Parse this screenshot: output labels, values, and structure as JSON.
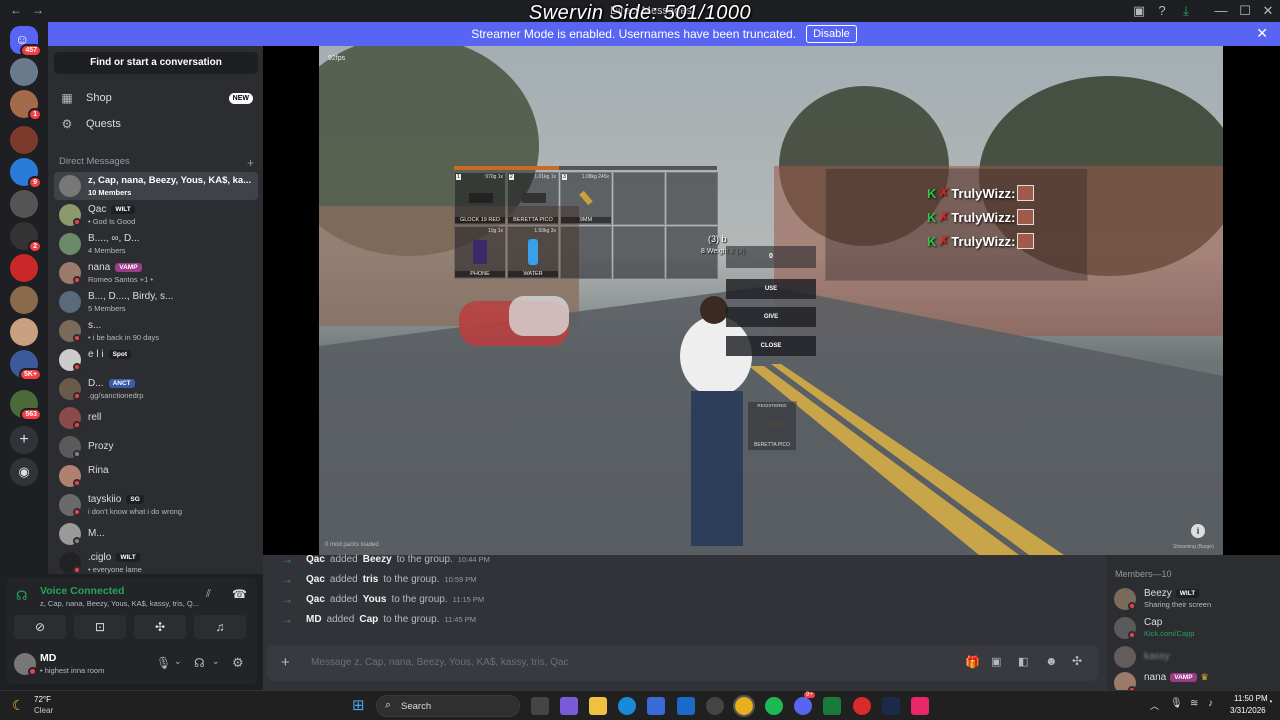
{
  "window": {
    "back": "←",
    "forward": "→",
    "title": "Direct Messages",
    "overlay_title": "Swervin Side: 501/1000"
  },
  "streamer_banner": {
    "text": "Streamer Mode is enabled. Usernames have been truncated.",
    "button": "Disable"
  },
  "guilds": {
    "home_badge": "457",
    "badges": [
      "1",
      "9",
      "2",
      "5K+",
      "563"
    ]
  },
  "sidebar": {
    "find": "Find or start a conversation",
    "shop": "Shop",
    "shop_badge": "NEW",
    "quests": "Quests",
    "dm_header": "Direct Messages",
    "add_dm": "+"
  },
  "dms": [
    {
      "name": "z, Cap, nana, Beezy, Yous, KA$, ka...",
      "sub": "10 Members",
      "tag": ""
    },
    {
      "name": "Qac",
      "sub": "• God Is Good",
      "tag": "WILT"
    },
    {
      "name": "B...., ∞, D...",
      "sub": "4 Members",
      "tag": ""
    },
    {
      "name": "nana",
      "sub": "Romeo Santos +1 •",
      "tag": "VAMP"
    },
    {
      "name": "B..., D...., Birdy, s...",
      "sub": "5 Members",
      "tag": ""
    },
    {
      "name": "s...",
      "sub": "• i be back in 90 days",
      "tag": ""
    },
    {
      "name": "e l i",
      "sub": "",
      "tag": "Spot"
    },
    {
      "name": "D...",
      "sub": ".gg/sanctionedrp",
      "tag": "ANCT"
    },
    {
      "name": "rell",
      "sub": "",
      "tag": ""
    },
    {
      "name": "Prozy",
      "sub": "",
      "tag": ""
    },
    {
      "name": "Rina",
      "sub": "",
      "tag": ""
    },
    {
      "name": "tayskiio",
      "sub": "i don't know what i do wrong",
      "tag": "SG"
    },
    {
      "name": "M...",
      "sub": "",
      "tag": ""
    },
    {
      "name": ".ciglo",
      "sub": "• everyone lame",
      "tag": "WILT"
    }
  ],
  "voice": {
    "status": "Voice Connected",
    "channel": "z, Cap, nana, Beezy, Yous, KA$, kassy, tris, Q..."
  },
  "user": {
    "name": "MD",
    "status": "• highest inna room"
  },
  "stream": {
    "fps": "92fps",
    "footer_left": "0 mod packs loaded",
    "footer_right": "Streaming (Barge)",
    "info": "i"
  },
  "game": {
    "inventory": [
      {
        "num": "1",
        "weight": "970g 1x",
        "label": "GLOCK 19 RED"
      },
      {
        "num": "2",
        "weight": "1.01kg 1x",
        "label": "BERETTA PICO"
      },
      {
        "num": "3",
        "weight": "1.08kg 245x",
        "label": "9MM"
      },
      {
        "num": "",
        "weight": "10g 1x",
        "label": "PHONE"
      },
      {
        "num": "",
        "weight": "1.50kg 3x",
        "label": "WATER"
      }
    ],
    "weight_line": "(3) b",
    "weight_sub": "8 Weight 2 (3)",
    "amount": "0",
    "use": "USE",
    "give": "GIVE",
    "close": "CLOSE",
    "registered": "REGISTERED",
    "registered_item": "BERETTA PICO",
    "truly": [
      "TrulyWizz:",
      "TrulyWizz:",
      "TrulyWizz:"
    ]
  },
  "chat": {
    "messages": [
      {
        "actor": "Qac",
        "verb": "added",
        "target": "Beezy",
        "rest": "to the group.",
        "time": "10:44 PM"
      },
      {
        "actor": "Qac",
        "verb": "added",
        "target": "tris",
        "rest": "to the group.",
        "time": "10:59 PM"
      },
      {
        "actor": "Qac",
        "verb": "added",
        "target": "Yous",
        "rest": "to the group.",
        "time": "11:15 PM"
      },
      {
        "actor": "MD",
        "verb": "added",
        "target": "Cap",
        "rest": "to the group.",
        "time": "11:45 PM"
      }
    ],
    "placeholder": "Message z, Cap, nana, Beezy, Yous, KA$, kassy, tris, Qac"
  },
  "members": {
    "header": "Members—10",
    "list": [
      {
        "name": "Beezy",
        "sub": "Sharing their screen",
        "tag": "WILT"
      },
      {
        "name": "Cap",
        "sub": "Kick.com/Capp",
        "tag": ""
      },
      {
        "name": "kassy",
        "sub": "",
        "tag": ""
      },
      {
        "name": "nana",
        "sub": "",
        "tag": "VAMP"
      }
    ]
  },
  "taskbar": {
    "temp": "72°F",
    "weather": "Clear",
    "search": "Search",
    "time": "11:50 PM",
    "date": "3/31/2026",
    "spotify_badge": "9+"
  },
  "colors": {
    "blurple": "#5865f2",
    "online": "#23a55a",
    "dnd": "#f23f43",
    "bg": "#313338"
  }
}
